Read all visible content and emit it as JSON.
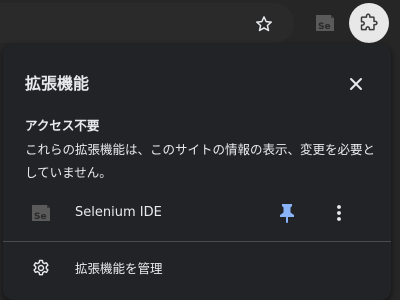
{
  "toolbar": {
    "star_icon": "star-outline-icon",
    "selenium_icon": "selenium-se-icon",
    "extensions_icon": "puzzle-icon"
  },
  "popup": {
    "title": "拡張機能",
    "close_icon": "close-icon",
    "section_heading": "アクセス不要",
    "section_description": "これらの拡張機能は、このサイトの情報の表示、変更を必要としていません。",
    "extension": {
      "name": "Selenium IDE",
      "icon": "selenium-se-icon",
      "pinned": true,
      "pin_color": "#8ab4f8"
    },
    "manage_label": "拡張機能を管理",
    "manage_icon": "gear-icon"
  }
}
